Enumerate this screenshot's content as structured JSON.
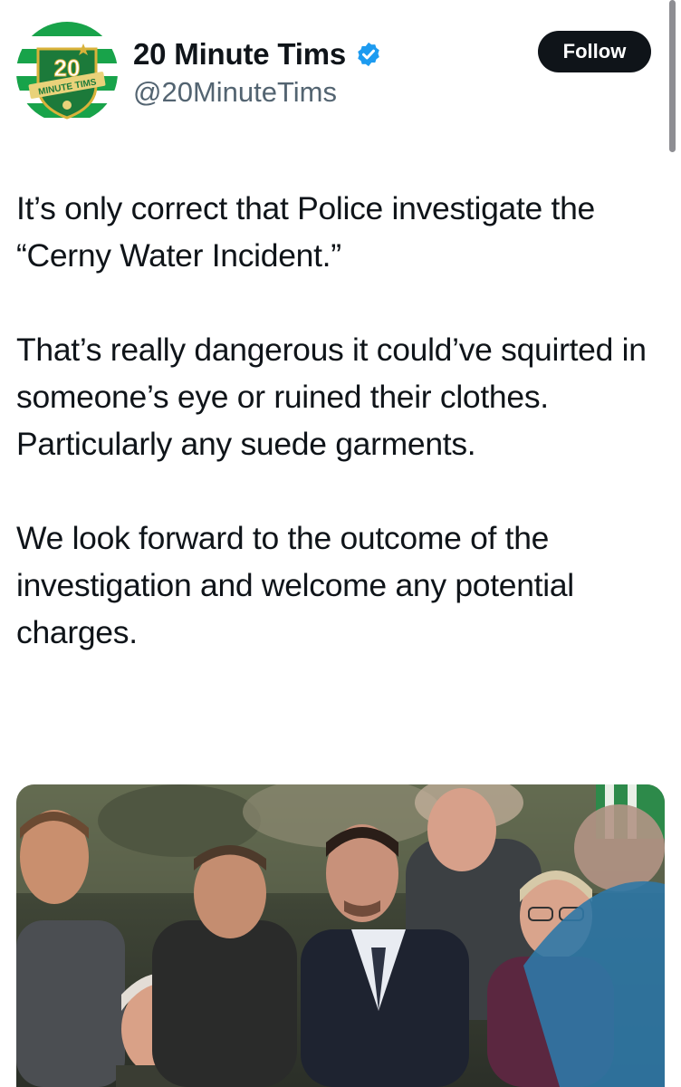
{
  "account": {
    "display_name": "20 Minute Tims",
    "handle": "@20MinuteTims",
    "verified": true,
    "avatar": {
      "badge_number": "20",
      "badge_banner": "MINUTE TIMS",
      "colors": {
        "green": "#18a34a",
        "white": "#ffffff",
        "gold": "#d9b23a"
      }
    }
  },
  "actions": {
    "follow_label": "Follow"
  },
  "tweet": {
    "paragraphs": [
      "It’s only correct that Police investigate the “Cerny Water Incident.”",
      "That’s really dangerous it could’ve squirted in someone’s eye or ruined their clothes. Particularly any suede garments.",
      "We look forward to the outcome of the investigation and welcome any potential charges."
    ]
  },
  "colors": {
    "text": "#0f1419",
    "secondary_text": "#536471",
    "follow_bg": "#0f1419",
    "verified_blue": "#1d9bf0"
  }
}
